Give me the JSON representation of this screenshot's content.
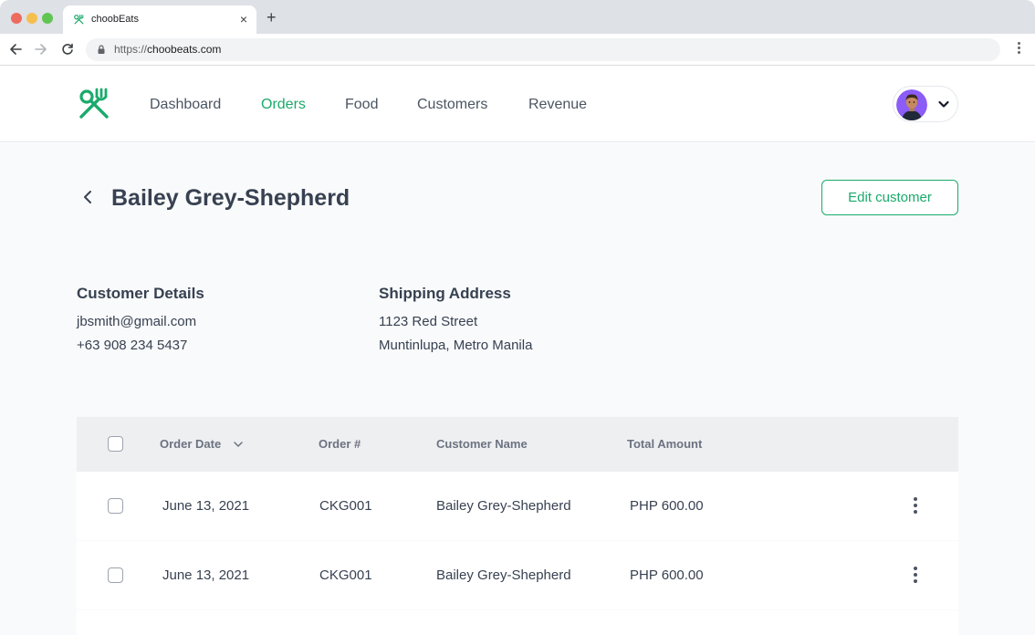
{
  "browser": {
    "tab_title": "choobEats",
    "url_scheme": "https://",
    "url_host": "choobeats.com",
    "tab_close": "×",
    "new_tab": "+"
  },
  "nav": {
    "items": [
      {
        "label": "Dashboard",
        "active": false
      },
      {
        "label": "Orders",
        "active": true
      },
      {
        "label": "Food",
        "active": false
      },
      {
        "label": "Customers",
        "active": false
      },
      {
        "label": "Revenue",
        "active": false
      }
    ]
  },
  "page": {
    "title": "Bailey Grey-Shepherd",
    "edit_button": "Edit customer"
  },
  "customer_details": {
    "heading": "Customer Details",
    "email": "jbsmith@gmail.com",
    "phone": "+63 908 234 5437"
  },
  "shipping_address": {
    "heading": "Shipping Address",
    "line1": "1123 Red Street",
    "line2": "Muntinlupa, Metro Manila"
  },
  "orders_table": {
    "columns": [
      "Order Date",
      "Order #",
      "Customer Name",
      "Total Amount"
    ],
    "rows": [
      {
        "date": "June 13, 2021",
        "order_no": "CKG001",
        "customer": "Bailey Grey-Shepherd",
        "amount": "PHP 600.00"
      },
      {
        "date": "June 13, 2021",
        "order_no": "CKG001",
        "customer": "Bailey Grey-Shepherd",
        "amount": "PHP 600.00"
      }
    ]
  },
  "colors": {
    "accent": "#1aaa6b",
    "text": "#374151",
    "page_bg": "#f9fafb"
  }
}
